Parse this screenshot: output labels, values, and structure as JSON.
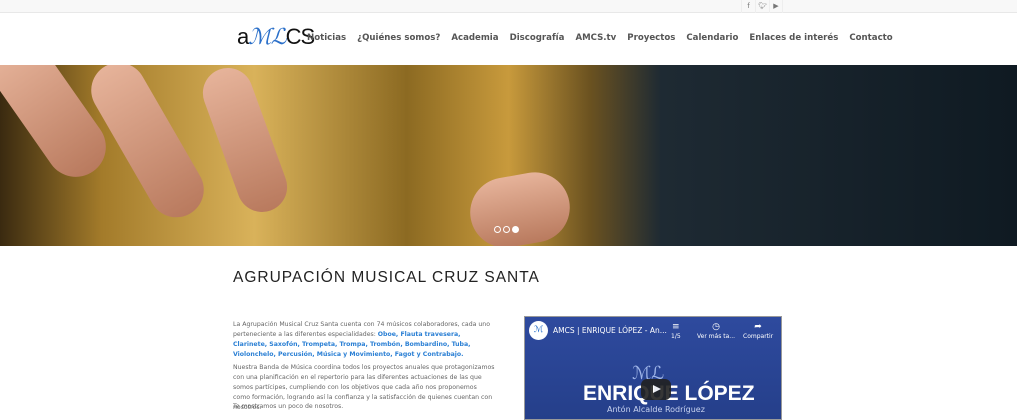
{
  "social": {
    "facebook": "f",
    "twitter": "t",
    "youtube": "yt"
  },
  "logo": {
    "pre": "a",
    "mark": "ℳ",
    "post": "CS"
  },
  "nav": [
    "Noticias",
    "¿Quiénes somos?",
    "Academia",
    "Discografía",
    "AMCS.tv",
    "Proyectos",
    "Calendario",
    "Enlaces de interés",
    "Contacto"
  ],
  "slider": {
    "slides": 3,
    "active": 3
  },
  "main": {
    "title": "AGRUPACIÓN MUSICAL CRUZ SANTA",
    "p1_text": "La Agrupación Musical Cruz Santa cuenta con 74 músicos colaboradores, cada uno perteneciente a las diferentes especialidades: ",
    "p1_links": "Oboe, Flauta travesera, Clarinete, Saxofón, Trompeta, Trompa, Trombón, Bombardino, Tuba, Violonchelo, Percusión, Música y Movimiento, Fagot y Contrabajo.",
    "p2": "Nuestra Banda de Música coordina todos los proyectos anuales que protagonizamos con una planificación en el repertorio para las diferentes actuaciones de las que somos partícipes, cumpliendo con los objetivos que cada año nos proponemos como formación, logrando así la confianza y la satisfacción de quienes cuentan con nosotros.",
    "p3": "Te mostramos un poco de nosotros."
  },
  "video": {
    "title": "AMCS | ENRIQUE LÓPEZ - An...",
    "playlist": "1/5",
    "watch_later": "Ver más ta...",
    "share": "Compartir",
    "heading": "ENRIQUE LÓPEZ",
    "subtitle": "Antón Alcalde Rodríguez",
    "accent": "#2e4a9e"
  }
}
